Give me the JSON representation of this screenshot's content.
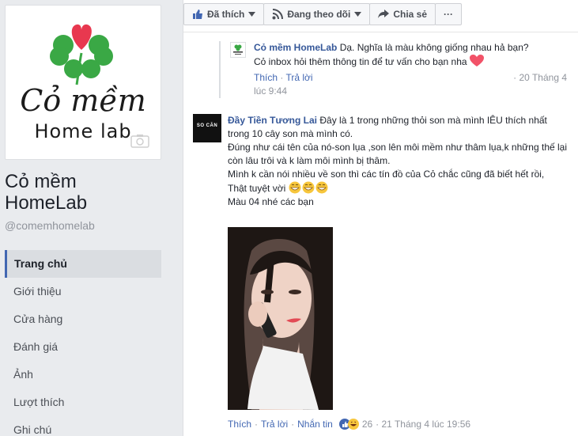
{
  "page": {
    "logo_title": "Cỏ mềm",
    "logo_sub": "Home lab",
    "name": "Cỏ mềm HomeLab",
    "handle": "@comemhomelab"
  },
  "nav": [
    {
      "label": "Trang chủ",
      "active": true
    },
    {
      "label": "Giới thiệu"
    },
    {
      "label": "Cửa hàng"
    },
    {
      "label": "Đánh giá"
    },
    {
      "label": "Ảnh"
    },
    {
      "label": "Lượt thích"
    },
    {
      "label": "Ghi chú"
    }
  ],
  "actions": {
    "like": "Đã thích",
    "follow": "Đang theo dõi",
    "share": "Chia sẻ",
    "more": "···"
  },
  "reply": {
    "author": "Cỏ mềm HomeLab",
    "line1": " Dạ. Nghĩa là màu không giống nhau hả bạn?",
    "line2": "Cỏ inbox hỏi thêm thông tin để tư vấn cho bạn nha",
    "like": "Thích",
    "reply": "Trả lời",
    "time_a": "· 20 Tháng 4",
    "time_b": "lúc 9:44"
  },
  "comment": {
    "avatar_text": "SO CĂN",
    "author": "Đầy Tiền Tương Lai",
    "text1": " Đây là 1 trong những thỏi son mà mình IÊU thích nhất trong 10 cây son mà mình có.",
    "text2": "Đúng như cái tên của nó-son lụa ,son lên môi mềm như thâm lụa,k những thế lại còn lâu trôi và k làm môi mình bị thâm.",
    "text3": "Mình k cần nói nhiều về son thì các tín đồ của Cỏ chắc cũng đã biết hết rồi,",
    "text4": "Thật tuyệt vời",
    "text5": "Màu 04 nhé các bạn",
    "like": "Thích",
    "reply": "Trả lời",
    "message": "Nhắn tin",
    "reaction_count": "26",
    "time": "· 21 Tháng 4 lúc 19:56"
  },
  "colors": {
    "fb_blue": "#4267b2",
    "link": "#365899",
    "leaf": "#3aa845",
    "heart": "#e8384f"
  }
}
